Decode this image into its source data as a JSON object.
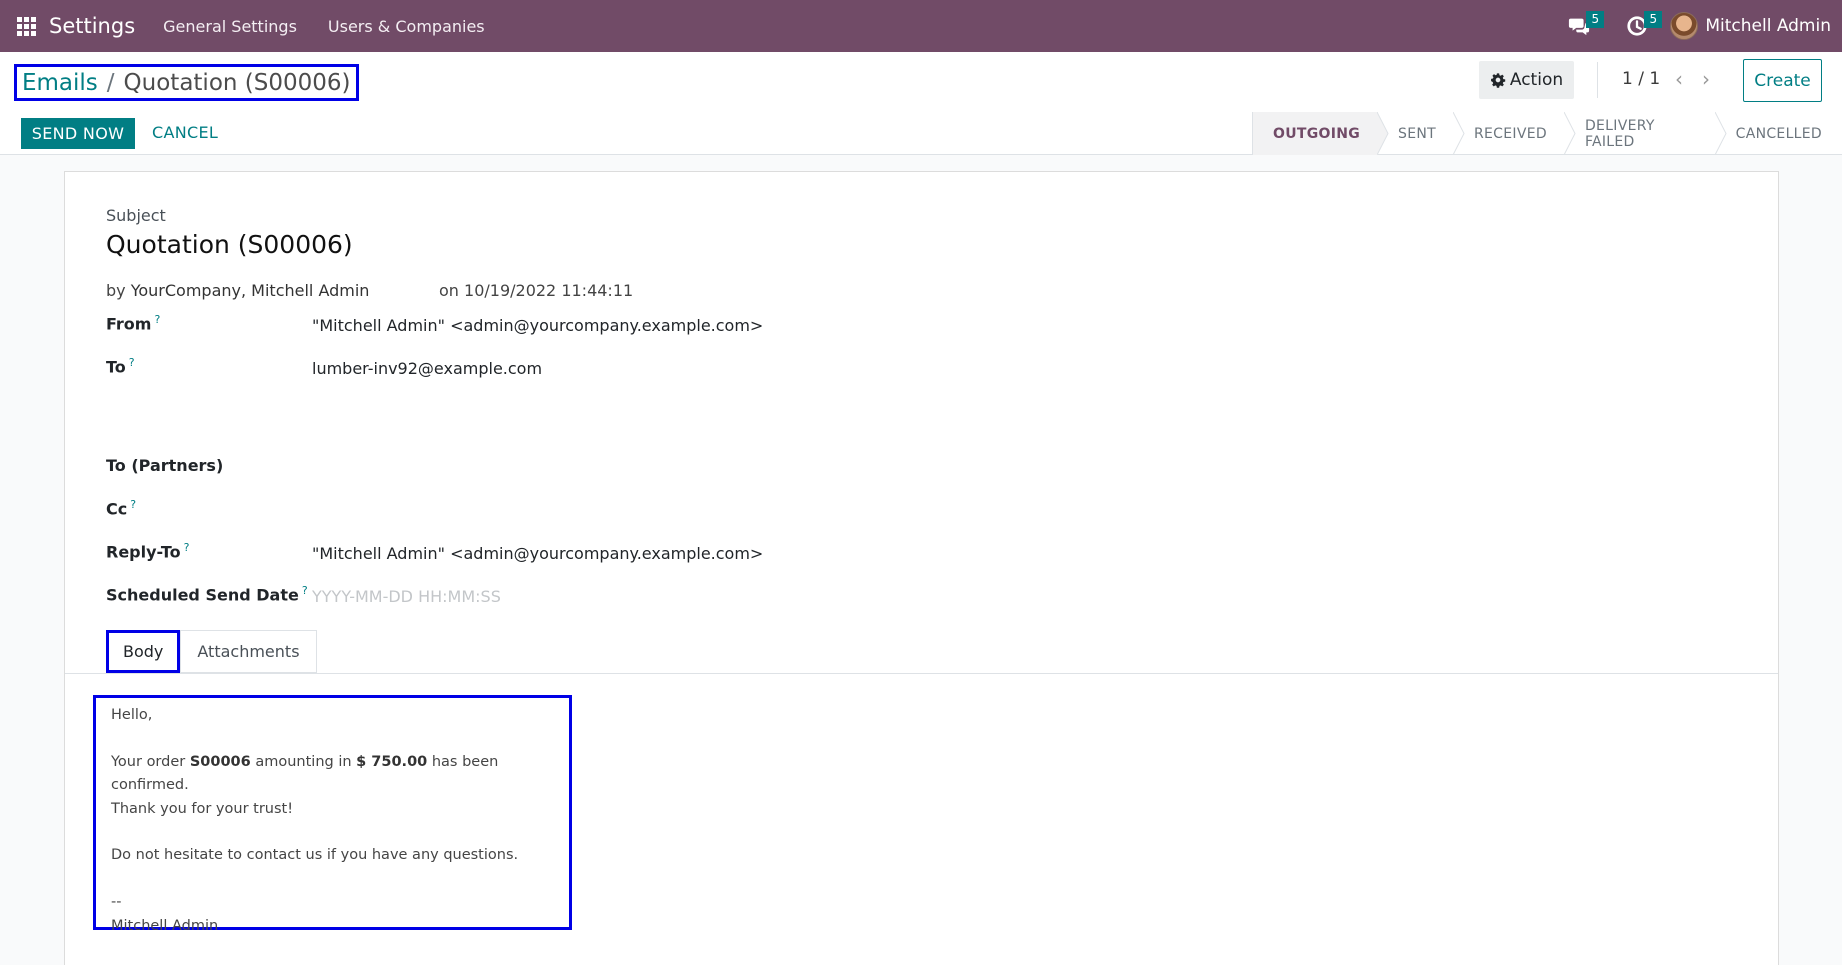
{
  "navbar": {
    "app_title": "Settings",
    "menu": [
      "General Settings",
      "Users & Companies"
    ],
    "messages_badge": "5",
    "activities_badge": "5",
    "user_name": "Mitchell Admin"
  },
  "control_panel": {
    "breadcrumb_parent": "Emails",
    "breadcrumb_separator": "/",
    "breadcrumb_current": "Quotation (S00006)",
    "action_label": "Action",
    "pager_value": "1 / 1",
    "create_label": "Create",
    "send_now_label": "SEND NOW",
    "cancel_label": "CANCEL",
    "statuses": [
      "OUTGOING",
      "SENT",
      "RECEIVED",
      "DELIVERY FAILED",
      "CANCELLED"
    ],
    "active_status": "OUTGOING"
  },
  "form": {
    "subject_label": "Subject",
    "subject_value": "Quotation (S00006)",
    "by_prefix": "by",
    "by_value": "YourCompany, Mitchell Admin",
    "on_value": "on 10/19/2022 11:44:11",
    "fields": {
      "from_label": "From",
      "from_value": "\"Mitchell Admin\" <admin@yourcompany.example.com>",
      "to_label": "To",
      "to_value": "lumber-inv92@example.com",
      "to_partners_label": "To (Partners)",
      "cc_label": "Cc",
      "reply_to_label": "Reply-To",
      "reply_to_value": "\"Mitchell Admin\" <admin@yourcompany.example.com>",
      "scheduled_label": "Scheduled Send Date",
      "scheduled_placeholder": "YYYY-MM-DD HH:MM:SS",
      "help_marker": "?"
    },
    "tabs": [
      "Body",
      "Attachments"
    ],
    "body": {
      "greeting": "Hello,",
      "line1_a": "Your order ",
      "order": "S00006",
      "line1_b": " amounting in ",
      "amount": "$ 750.00",
      "line1_c": " has been confirmed.",
      "line2": "Thank you for your trust!",
      "line3": "Do not hesitate to contact us if you have any questions.",
      "sig_sep": "--",
      "signature": "Mitchell Admin"
    }
  },
  "colors": {
    "navbar": "#714b67",
    "primary": "#017e84",
    "highlight_border": "#0000e6"
  }
}
